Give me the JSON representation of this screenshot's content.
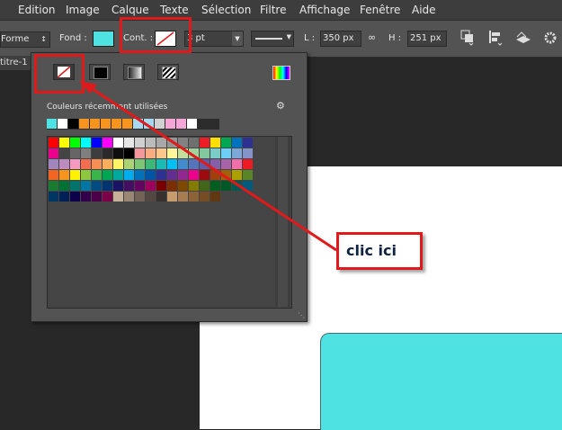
{
  "menu": [
    "Edition",
    "Image",
    "Calque",
    "Texte",
    "Sélection",
    "Filtre",
    "Affichage",
    "Fenêtre",
    "Aide"
  ],
  "options": {
    "mode_value": "Forme",
    "fill_label": "Fond :",
    "fill_color": "#4fe2e3",
    "stroke_label": "Cont. :",
    "stroke_width_value": "3 pt",
    "width_label": "L :",
    "width_value": "350 px",
    "link_icon": "link-icon",
    "height_label": "H :",
    "height_value": "251 px"
  },
  "document_tab": "titre-1",
  "swatch_panel": {
    "recent_title": "Couleurs récemment utilisées",
    "recent_colors": [
      "#4fe2e3",
      "#ffffff",
      "#000000",
      "#f7941d",
      "#f7941d",
      "#f7941d",
      "#f7941d",
      "#f7941d",
      "#a8d8ef",
      "#a8d8ef",
      "#d0d0d0",
      "#f4a7d6",
      "#f4a7d6",
      "#ffffff"
    ],
    "grid_rows": [
      [
        "#ff0000",
        "#ffff00",
        "#00ff00",
        "#00ffff",
        "#0000ff",
        "#ff00ff",
        "#ffffff",
        "#e6e6e6",
        "#d0d0d0",
        "#bcbcbc",
        "#a8a8a8",
        "#959595",
        "#828282",
        "#707070",
        "#ee1c24",
        "#ffde00",
        "#00a651",
        "#0072bc",
        "#2e3192"
      ],
      [
        "#ec008c",
        "#444444",
        "#666666",
        "#7f7f7f",
        "#3d3d3d",
        "#2a2a2a",
        "#0f0f0f",
        "#000000",
        "#f5989d",
        "#f9ad81",
        "#fdc68a",
        "#fff799",
        "#c4df9b",
        "#a3d39c",
        "#82ca9d",
        "#7accc8",
        "#6dcff6",
        "#7da7d9",
        "#8493ca"
      ],
      [
        "#a186be",
        "#bd8cbf",
        "#f49ac1",
        "#f26c4f",
        "#f68e56",
        "#fbaf5d",
        "#fff467",
        "#acd373",
        "#7cc576",
        "#3bb878",
        "#1abbb4",
        "#00bff3",
        "#438ccb",
        "#5574b9",
        "#605ca8",
        "#855fa8",
        "#a763a8",
        "#f06eaa",
        "#ed1c24"
      ],
      [
        "#f26522",
        "#f7941d",
        "#fff200",
        "#8dc63f",
        "#39b54a",
        "#00a651",
        "#00a99d",
        "#00aeef",
        "#0072bc",
        "#0054a6",
        "#2e3192",
        "#662d91",
        "#92278f",
        "#ec008c",
        "#9e0b0f",
        "#a0410d",
        "#a36209",
        "#aba000",
        "#598527"
      ],
      [
        "#1a7b30",
        "#007236",
        "#00746b",
        "#0076a3",
        "#004b80",
        "#003471",
        "#1b1464",
        "#440e62",
        "#630460",
        "#9e005d",
        "#790000",
        "#7b2e00",
        "#7d4900",
        "#827b00",
        "#406618",
        "#005e20",
        "#005826",
        "#005952",
        "#005b7f"
      ],
      [
        "#003663",
        "#002157",
        "#0d004c",
        "#32004b",
        "#4b0049",
        "#7b0046",
        "#c7b299",
        "#998675",
        "#736357",
        "#534741",
        "#37302d",
        "#c69c6d",
        "#a67c52",
        "#8c6239",
        "#754c24",
        "#603913"
      ]
    ]
  },
  "callout": {
    "text": "clic ici"
  }
}
